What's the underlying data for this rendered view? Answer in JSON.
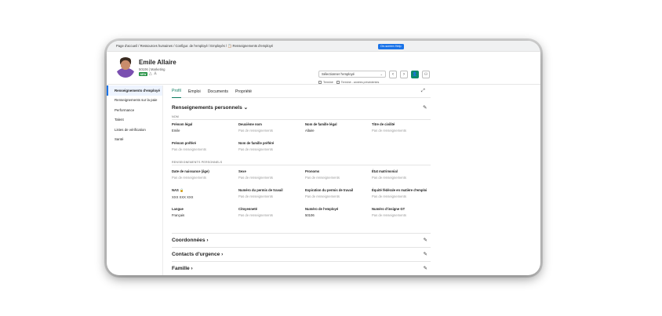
{
  "breadcrumb": "Page d'accueil / Ressources humaines / Configur. de l'employé / Employés / 📋 Renseignements d'employé",
  "help_button": "On-screen Help",
  "employee": {
    "name": "Emile Allaire",
    "subtitle": "50106 | Marketing",
    "badge": "NEW",
    "icon_a": "△",
    "icon_b": "♙"
  },
  "employee_select": {
    "placeholder": "Sélectionner l'employé",
    "chevron": "⌄",
    "prev": "‹",
    "next": "›",
    "person_icon": "👤",
    "people_icon": "⚇",
    "check_1": "Terminé",
    "check_2": "Terminé - années précédentes"
  },
  "sidebar": {
    "items": [
      {
        "label": "Renseignements d'employé"
      },
      {
        "label": "Renseignements sur la paie"
      },
      {
        "label": "Performance"
      },
      {
        "label": "Talent"
      },
      {
        "label": "Listes de vérification"
      },
      {
        "label": "Santé"
      }
    ]
  },
  "tabs": [
    {
      "label": "Profil"
    },
    {
      "label": "Emploi"
    },
    {
      "label": "Documents"
    },
    {
      "label": "Propriété"
    }
  ],
  "expand_icon": "⤢",
  "personal": {
    "title": "Renseignements personnels",
    "chevron": "⌄",
    "pencil": "✎",
    "group_name": "NOM",
    "group_personal": "RENSEIGNEMENTS PERSONNELS",
    "fields": [
      {
        "label": "Prénom légal",
        "value": "Emile"
      },
      {
        "label": "Deuxième nom",
        "value": "Pas de renseignements"
      },
      {
        "label": "Nom de famille légal",
        "value": "Allaire"
      },
      {
        "label": "Titre de civilité",
        "value": "Pas de renseignements"
      },
      {
        "label": "Prénom préféré",
        "value": "Pas de renseignements"
      },
      {
        "label": "Nom de famille préféré",
        "value": "Pas de renseignements"
      },
      {
        "label": "Date de naissance (âge)",
        "value": "Pas de renseignements"
      },
      {
        "label": "Sexe",
        "value": "Pas de renseignements"
      },
      {
        "label": "Pronoms",
        "value": "Pas de renseignements"
      },
      {
        "label": "État matrimonial",
        "value": "Pas de renseignements"
      },
      {
        "label": "NAS 🔒",
        "value": "XXX XXX XXX"
      },
      {
        "label": "Numéro du permis de travail",
        "value": "Pas de renseignements"
      },
      {
        "label": "Expiration du permis de travail",
        "value": "Pas de renseignements"
      },
      {
        "label": "Équité fédérale en matière d'emploi",
        "value": "Pas de renseignements"
      },
      {
        "label": "Langue",
        "value": "Français"
      },
      {
        "label": "Citoyenneté",
        "value": "Pas de renseignements"
      },
      {
        "label": "Numéro de l'employé",
        "value": "50106"
      },
      {
        "label": "Numéro d'insigne GT",
        "value": "Pas de renseignements"
      }
    ]
  },
  "collapsed_sections": [
    {
      "title": "Coordonnées ›"
    },
    {
      "title": "Contacts d'urgence ›"
    },
    {
      "title": "Famille ›"
    }
  ]
}
